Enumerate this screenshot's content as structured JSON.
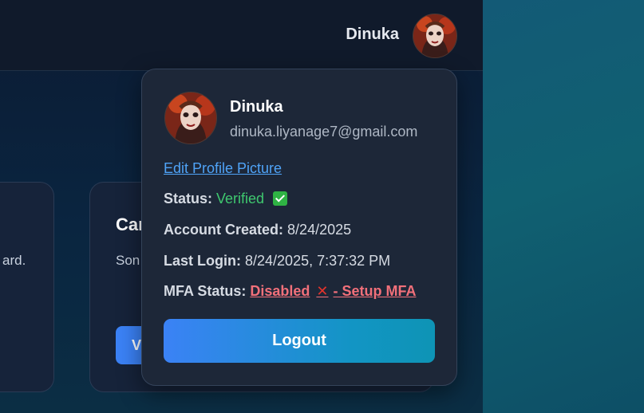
{
  "header": {
    "user_name": "Dinuka"
  },
  "background_cards": {
    "left_card_desc_fragment": "ard.",
    "mid_card_title_fragment": "Car",
    "mid_card_desc_fragment": "Son",
    "mid_card_button_fragment": "V"
  },
  "dropdown": {
    "name": "Dinuka",
    "email": "dinuka.liyanage7@gmail.com",
    "edit_picture_link": "Edit Profile Picture",
    "status_label": "Status:",
    "status_value": "Verified",
    "account_created_label": "Account Created:",
    "account_created_value": "8/24/2025",
    "last_login_label": "Last Login:",
    "last_login_value": "8/24/2025, 7:37:32 PM",
    "mfa_label": "MFA Status:",
    "mfa_disabled_text": "Disabled",
    "mfa_setup_text": "- Setup MFA",
    "logout_button": "Logout"
  },
  "icons": {
    "status_check": "check-mark-icon",
    "mfa_cross": "cross-mark-icon",
    "avatar": "avatar-image"
  },
  "colors": {
    "verified_green": "#3fc86f",
    "mfa_red": "#f2707a",
    "link_blue": "#4fa3f7",
    "logout_gradient_start": "#3b82f6",
    "logout_gradient_end": "#0e94b5"
  }
}
